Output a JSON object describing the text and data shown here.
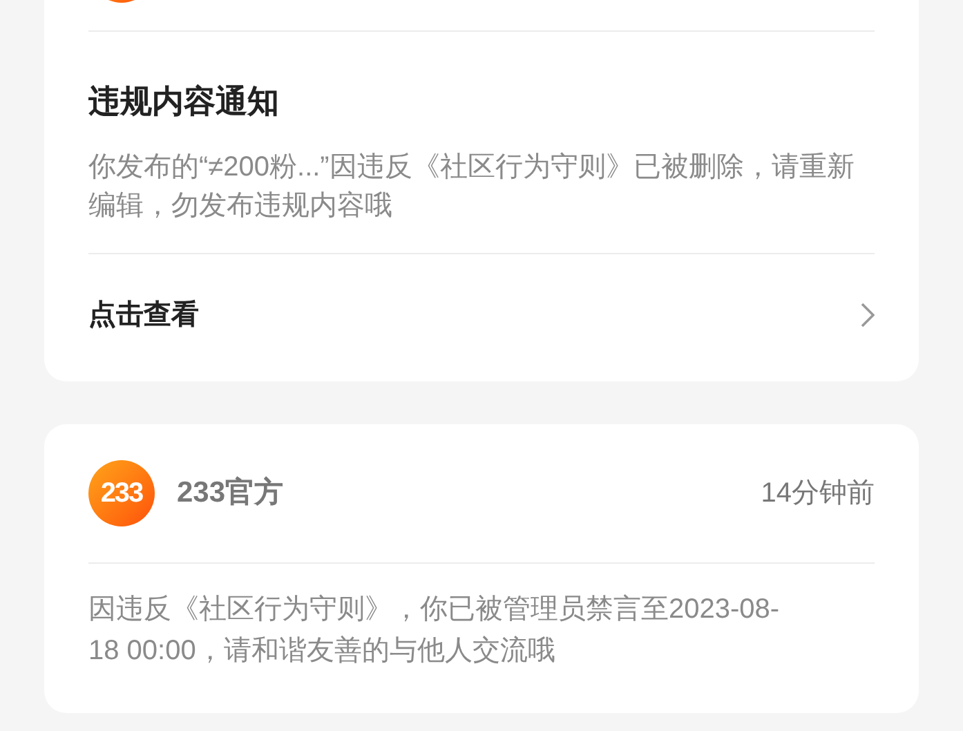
{
  "notices": [
    {
      "kind": "partial",
      "title": "违规内容通知",
      "body": "你发布的“≠200粉...”因违反《社区行为守则》已被删除，请重新编辑，勿发布违规内容哦",
      "link": "点击查看"
    },
    {
      "kind": "full",
      "logo_text": "233",
      "sender": "233官方",
      "time": "14分钟前",
      "body": "因违反《社区行为守则》，你已被管理员禁言至2023-08-18 00:00，请和谐友善的与他人交流哦"
    }
  ]
}
